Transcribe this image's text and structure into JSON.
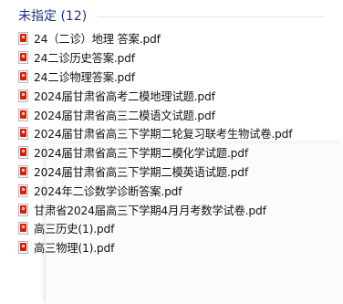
{
  "group": {
    "title": "未指定 (12)"
  },
  "files": [
    {
      "name": "24（二诊）地理 答案.pdf",
      "icon": "pdf-icon"
    },
    {
      "name": "24二诊历史答案.pdf",
      "icon": "pdf-icon"
    },
    {
      "name": "24二诊物理答案.pdf",
      "icon": "pdf-icon"
    },
    {
      "name": "2024届甘肃省高考二模地理试题.pdf",
      "icon": "pdf-icon"
    },
    {
      "name": "2024届甘肃省高三二模语文试题.pdf",
      "icon": "pdf-icon"
    },
    {
      "name": "2024届甘肃省高三下学期二轮复习联考生物试卷.pdf",
      "icon": "pdf-icon"
    },
    {
      "name": "2024届甘肃省高三下学期二模化学试题.pdf",
      "icon": "pdf-icon"
    },
    {
      "name": "2024届甘肃省高三下学期二模英语试题.pdf",
      "icon": "pdf-icon"
    },
    {
      "name": "2024年二诊数学诊断答案.pdf",
      "icon": "pdf-icon"
    },
    {
      "name": "甘肃省2024届高三下学期4月月考数学试卷.pdf",
      "icon": "pdf-icon"
    },
    {
      "name": "高三历史(1).pdf",
      "icon": "pdf-icon"
    },
    {
      "name": "高三物理(1).pdf",
      "icon": "pdf-icon"
    }
  ],
  "colors": {
    "group_title": "#1e3287",
    "pdf_red": "#d81e06",
    "text": "#141414"
  }
}
